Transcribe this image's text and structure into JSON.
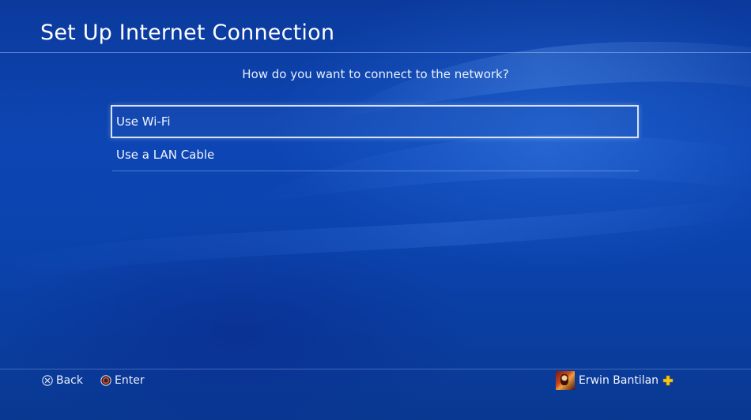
{
  "header": {
    "title": "Set Up Internet Connection"
  },
  "main": {
    "prompt": "How do you want to connect to the network?",
    "options": [
      {
        "label": "Use Wi-Fi",
        "selected": true
      },
      {
        "label": "Use a LAN Cable",
        "selected": false
      }
    ]
  },
  "footer": {
    "back_label": "Back",
    "back_icon": "cross-button-icon",
    "enter_label": "Enter",
    "enter_icon": "circle-button-icon",
    "user_name": "Erwin Bantilan",
    "plus_icon": "playstation-plus-icon",
    "plus_color": "#f5c518"
  },
  "colors": {
    "background": "#0d46b4",
    "selection_border": "#d9e2f5"
  }
}
